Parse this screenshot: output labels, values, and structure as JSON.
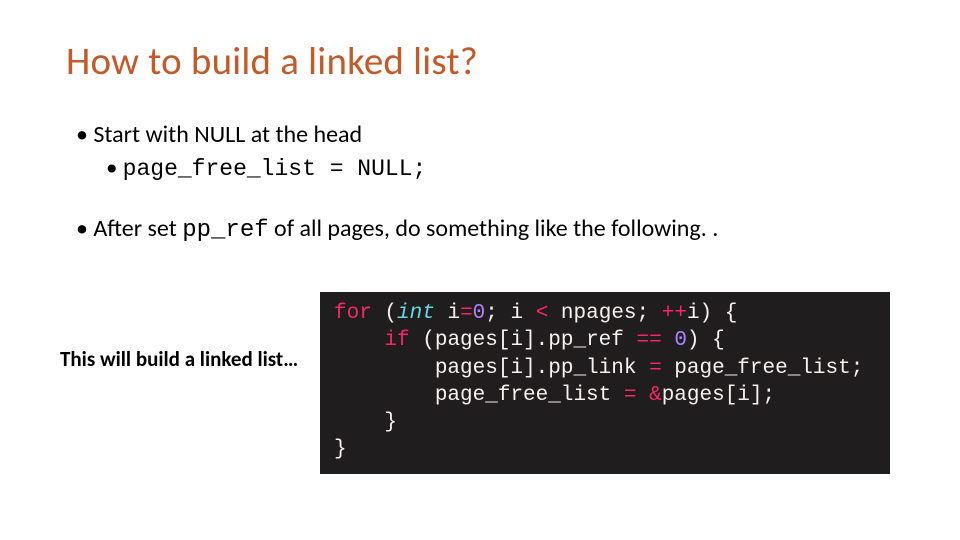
{
  "title": "How to build a linked list?",
  "bullets": {
    "b1": "Start with NULL at the head",
    "b1a": "page_free_list = NULL;",
    "b2_pre": "After set ",
    "b2_code": "pp_ref",
    "b2_post": " of all pages, do something like the following. ."
  },
  "aside": "This will build a linked list…",
  "code": {
    "for": "for",
    "lpar": " (",
    "int": "int",
    "decl": " i",
    "assign": "=",
    "zero": "0",
    "semi1": "; i ",
    "lt": "<",
    "npages": " npages; ",
    "inc": "++",
    "i2": "i) {",
    "l2_indent": "    ",
    "if": "if",
    "cond_open": " (pages[i].pp_ref ",
    "eq": "==",
    "sp": " ",
    "zero2": "0",
    "cond_close": ") {",
    "l3a_indent": "        ",
    "l3a": "pages[i].pp_link ",
    "l3a_eq": "=",
    "l3a_rhs": " page_free_list;",
    "l3b_indent": "        ",
    "l3b": "page_free_list ",
    "l3b_eq": "=",
    "l3b_rhs": " ",
    "amp": "&",
    "l3b_rhs2": "pages[i];",
    "l4_indent": "    ",
    "brace_close_inner": "}",
    "brace_close_outer": "}"
  }
}
